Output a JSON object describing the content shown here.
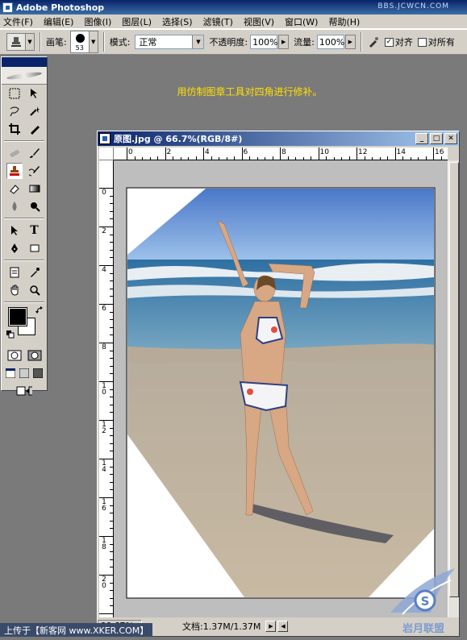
{
  "app": {
    "title": "Adobe Photoshop",
    "watermark": "BBS.JCWCN.COM"
  },
  "menu": [
    "文件(F)",
    "编辑(E)",
    "图像(I)",
    "图层(L)",
    "选择(S)",
    "滤镜(T)",
    "视图(V)",
    "窗口(W)",
    "帮助(H)"
  ],
  "options": {
    "brush_label": "画笔:",
    "brush_size": "53",
    "mode_label": "模式:",
    "mode_value": "正常",
    "opacity_label": "不透明度:",
    "opacity_value": "100%",
    "flow_label": "流量:",
    "flow_value": "100%",
    "align_label": "对齐",
    "all_layers_label": "对所有"
  },
  "caption": "用仿制图章工具对四角进行修补。",
  "document": {
    "title": "原图.jpg @ 66.7%(RGB/8#)",
    "hruler_labels": [
      "0",
      "2",
      "4",
      "6",
      "8",
      "10",
      "12",
      "14",
      "16"
    ],
    "vruler_labels": [
      "0",
      "2",
      "4",
      "6",
      "8",
      "10",
      "12",
      "14",
      "16",
      "18",
      "20"
    ],
    "zoom": "66.67%",
    "doc_info": "文档:1.37M/1.37M"
  },
  "footer": {
    "credit": "上传于【新客网 www.XKER.COM】"
  },
  "logo": {
    "text": "岩月联盟"
  },
  "colors": {
    "accent": "#0a246a",
    "caption": "#ffe000",
    "panel": "#d4d0c8",
    "workspace": "#7a7a7a"
  }
}
